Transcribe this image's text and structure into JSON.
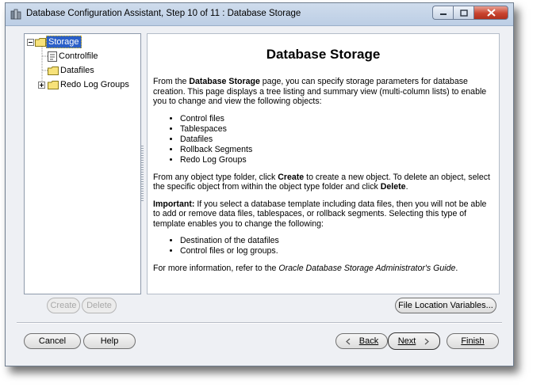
{
  "window": {
    "title": "Database Configuration Assistant, Step 10 of 11 : Database Storage"
  },
  "tree": {
    "root": "Storage",
    "items": [
      "Controlfile",
      "Datafiles",
      "Redo Log Groups"
    ]
  },
  "content": {
    "heading": "Database Storage",
    "intro_before": "From the ",
    "intro_bold": "Database Storage",
    "intro_after": " page, you can specify storage parameters for database creation. This page displays a tree listing and summary view (multi-column lists) to enable you to change and view the following objects:",
    "objects": [
      "Control files",
      "Tablespaces",
      "Datafiles",
      "Rollback Segments",
      "Redo Log Groups"
    ],
    "create_p1": "From any object type folder, click ",
    "create_bold": "Create",
    "create_p2": " to create a new object. To delete an object, select the specific object from within the object type folder and click ",
    "delete_bold": "Delete",
    "create_p3": ".",
    "important_bold": "Important:",
    "important_text": " If you select a database template including data files, then you will not be able to add or remove data files, tablespaces, or rollback segments. Selecting this type of template enables you to change the following:",
    "changeables": [
      "Destination of the datafiles",
      "Control files or log groups."
    ],
    "more_info": "For more information, refer to the ",
    "guide": "Oracle Database Storage Administrator's Guide",
    "more_info_end": "."
  },
  "buttons": {
    "create": "Create",
    "delete": "Delete",
    "file_location": "File Location Variables...",
    "cancel": "Cancel",
    "help": "Help",
    "back": "Back",
    "next": "Next",
    "finish": "Finish"
  }
}
